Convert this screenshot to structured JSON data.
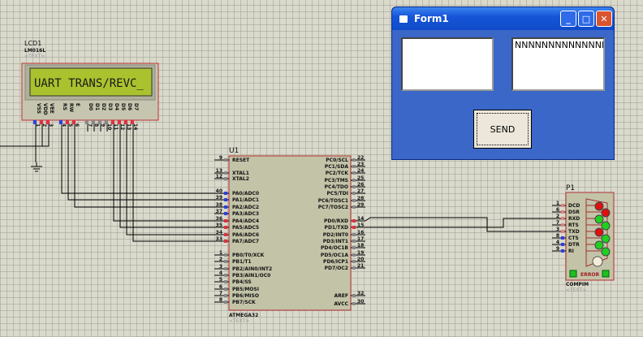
{
  "lcd": {
    "ref": "LCD1",
    "part": "LM016L",
    "text_placeholder": "<TEXT>",
    "display": "UART TRANS/REVC_",
    "screen_color": "#a9c22e",
    "pins": [
      {
        "n": "1",
        "l": "VSS"
      },
      {
        "n": "2",
        "l": "VDD"
      },
      {
        "n": "3",
        "l": "VEE"
      },
      {
        "n": "4",
        "l": "RS"
      },
      {
        "n": "5",
        "l": "RW"
      },
      {
        "n": "6",
        "l": "E"
      },
      {
        "n": "7",
        "l": "D0"
      },
      {
        "n": "8",
        "l": "D1"
      },
      {
        "n": "9",
        "l": "D2"
      },
      {
        "n": "10",
        "l": "D3"
      },
      {
        "n": "11",
        "l": "D4"
      },
      {
        "n": "12",
        "l": "D5"
      },
      {
        "n": "13",
        "l": "D6"
      },
      {
        "n": "14",
        "l": "D7"
      }
    ]
  },
  "mcu": {
    "ref": "U1",
    "part": "ATMEGA32",
    "text_placeholder": "<TEXT>",
    "left_pins": [
      {
        "n": "9",
        "l": "RESET"
      },
      {
        "n": "13",
        "l": "XTAL1"
      },
      {
        "n": "12",
        "l": "XTAL2"
      },
      {
        "n": "40",
        "l": "PA0/ADC0"
      },
      {
        "n": "39",
        "l": "PA1/ADC1"
      },
      {
        "n": "38",
        "l": "PA2/ADC2"
      },
      {
        "n": "37",
        "l": "PA3/ADC3"
      },
      {
        "n": "36",
        "l": "PA4/ADC4"
      },
      {
        "n": "35",
        "l": "PA5/ADC5"
      },
      {
        "n": "34",
        "l": "PA6/ADC6"
      },
      {
        "n": "33",
        "l": "PA7/ADC7"
      },
      {
        "n": "1",
        "l": "PB0/T0/XCK"
      },
      {
        "n": "2",
        "l": "PB1/T1"
      },
      {
        "n": "3",
        "l": "PB2/AIN0/INT2"
      },
      {
        "n": "4",
        "l": "PB3/AIN1/OC0"
      },
      {
        "n": "5",
        "l": "PB4/SS"
      },
      {
        "n": "6",
        "l": "PB5/MOSI"
      },
      {
        "n": "7",
        "l": "PB6/MISO"
      },
      {
        "n": "8",
        "l": "PB7/SCK"
      }
    ],
    "right_pins": [
      {
        "n": "22",
        "l": "PC0/SCL"
      },
      {
        "n": "23",
        "l": "PC1/SDA"
      },
      {
        "n": "24",
        "l": "PC2/TCK"
      },
      {
        "n": "25",
        "l": "PC3/TMS"
      },
      {
        "n": "26",
        "l": "PC4/TDO"
      },
      {
        "n": "27",
        "l": "PC5/TDI"
      },
      {
        "n": "28",
        "l": "PC6/TOSC1"
      },
      {
        "n": "29",
        "l": "PC7/TOSC2"
      },
      {
        "n": "14",
        "l": "PD0/RXD"
      },
      {
        "n": "15",
        "l": "PD1/TXD"
      },
      {
        "n": "16",
        "l": "PD2/INT0"
      },
      {
        "n": "17",
        "l": "PD3/INT1"
      },
      {
        "n": "18",
        "l": "PD4/OC1B"
      },
      {
        "n": "19",
        "l": "PD5/OC1A"
      },
      {
        "n": "20",
        "l": "PD6/ICP1"
      },
      {
        "n": "21",
        "l": "PD7/OC2"
      },
      {
        "n": "32",
        "l": "AREF"
      },
      {
        "n": "30",
        "l": "AVCC"
      }
    ]
  },
  "com": {
    "ref": "P1",
    "part": "COMPIM",
    "text_placeholder": "<TEXT>",
    "error_label": "ERROR",
    "pins": [
      {
        "n": "1",
        "l": "DCD",
        "led": "red"
      },
      {
        "n": "6",
        "l": "DSR",
        "led": "red"
      },
      {
        "n": "2",
        "l": "RXD",
        "led": "green"
      },
      {
        "n": "7",
        "l": "RTS",
        "led": "green"
      },
      {
        "n": "3",
        "l": "TXD",
        "led": "red"
      },
      {
        "n": "8",
        "l": "CTS",
        "led": "green"
      },
      {
        "n": "4",
        "l": "DTR",
        "led": "green"
      },
      {
        "n": "9",
        "l": "RI",
        "led": "green"
      }
    ]
  },
  "form": {
    "title": "Form1",
    "left_textbox": "",
    "right_textbox": "NNNNNNNNNNNNNNN",
    "send_label": "SEND",
    "minimize": "_",
    "maximize": "□",
    "close": "✕"
  }
}
